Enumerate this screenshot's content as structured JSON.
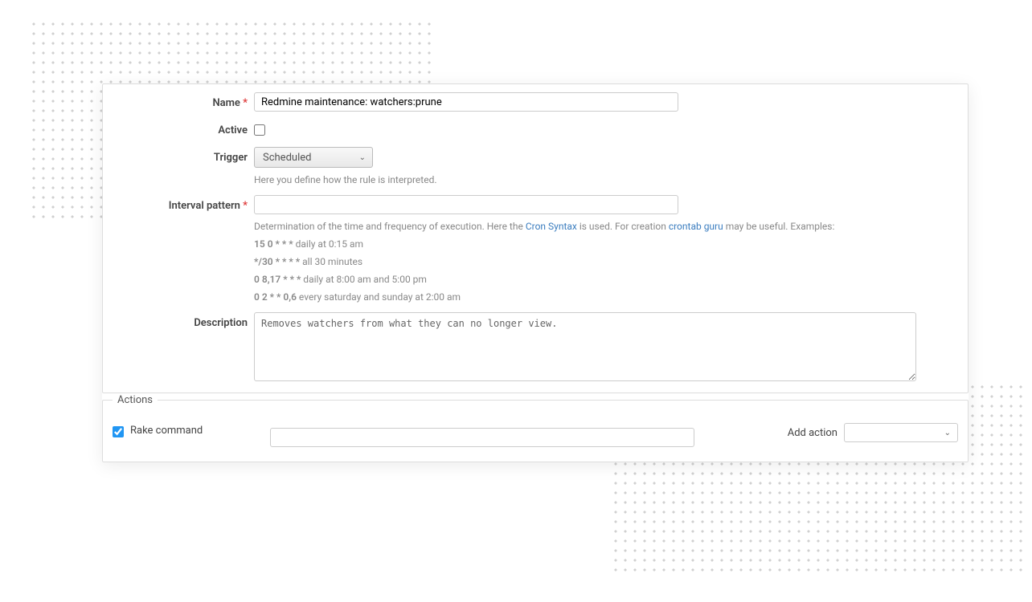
{
  "form": {
    "name_label": "Name",
    "name_value": "Redmine maintenance: watchers:prune",
    "active_label": "Active",
    "active_checked": false,
    "trigger_label": "Trigger",
    "trigger_value": "Scheduled",
    "trigger_help": "Here you define how the rule is interpreted.",
    "interval_label": "Interval pattern",
    "interval_value": "",
    "interval_help_prefix": "Determination of the time and frequency of execution. Here the ",
    "interval_help_link1": "Cron Syntax",
    "interval_help_mid": " is used. For creation ",
    "interval_help_link2": "crontab guru",
    "interval_help_suffix": " may be useful. Examples:",
    "examples": [
      {
        "pattern": "15 0 * * *",
        "desc": " daily at 0:15 am"
      },
      {
        "pattern": "*/30 * * * *",
        "desc": " all 30 minutes"
      },
      {
        "pattern": "0 8,17 * * *",
        "desc": " daily at 8:00 am and 5:00 pm"
      },
      {
        "pattern": "0 2 * * 0,6",
        "desc": " every saturday and sunday at 2:00 am"
      }
    ],
    "description_label": "Description",
    "description_value": "Removes watchers from what they can no longer view."
  },
  "actions": {
    "legend": "Actions",
    "rake_label": "Rake command",
    "rake_checked": true,
    "rake_value": "",
    "add_label": "Add action",
    "add_value": ""
  }
}
